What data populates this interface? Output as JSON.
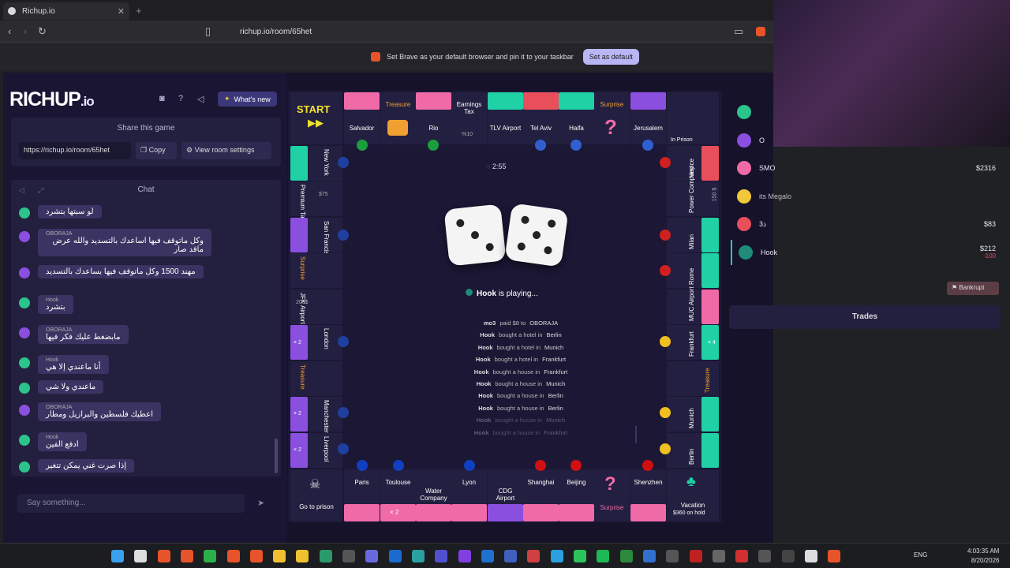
{
  "browser": {
    "tab_title": "Richup.io",
    "url": "richup.io/room/65het",
    "infobar_text": "Set Brave as your default browser and pin it to your taskbar",
    "infobar_button": "Set as default"
  },
  "app": {
    "logo": "RICHUP",
    "logo_suffix": ".io",
    "whats_new": "What's new",
    "share_title": "Share this game",
    "share_url": "https://richup.io/room/65het",
    "copy_label": "Copy",
    "view_room_label": "View room settings",
    "chat_title": "Chat",
    "say_placeholder": "Say something...",
    "chat": [
      {
        "name": "",
        "text": "لو سبتها بتشرد",
        "color": "#2bc48a"
      },
      {
        "name": "OBORAJA",
        "text": "وكل ماتوقف فيها اساعدك بالتسديد والله عرض ماقد صار",
        "color": "#8b4fe0"
      },
      {
        "name": "",
        "text": "مهند 1500 وكل ماتوقف فيها بساعدك بالتسديد",
        "color": "#8b4fe0"
      },
      {
        "name": "Hook",
        "text": "بتشرد",
        "color": "#2bc48a"
      },
      {
        "name": "OBORAJA",
        "text": "مابضغط عليك فكر فيها",
        "color": "#8b4fe0"
      },
      {
        "name": "Hook",
        "text": "أنا ماعندي إلا هي",
        "color": "#2bc48a"
      },
      {
        "name": "",
        "text": "ماعندي ولا شي",
        "color": "#2bc48a"
      },
      {
        "name": "OBORAJA",
        "text": "اعطيك فلسطين والبرازيل ومطار",
        "color": "#8b4fe0"
      },
      {
        "name": "Hook",
        "text": "ادفع الفين",
        "color": "#2bc48a"
      },
      {
        "name": "",
        "text": "إذا صرت غني يمكن تتغير",
        "color": "#2bc48a"
      }
    ]
  },
  "board": {
    "top": [
      "START",
      "Salvador",
      "Treasure",
      "Rio",
      "Earnings Tax",
      "TLV Airport",
      "Tel Aviv",
      "Haifa",
      "Surprise",
      "Jerusalem",
      "In Prison"
    ],
    "earnings_tax_value": "%10",
    "left": [
      "New York",
      "Premium Tax",
      "San Francisco",
      "Surprise",
      "JFK Airport",
      "London",
      "Treasure",
      "Manchester",
      "Liverpool"
    ],
    "premium_tax_value": "$75",
    "jfk_value": "200$",
    "right": [
      "Venice",
      "Power Company",
      "Milan",
      "Rome",
      "MUC Airport",
      "Frankfurt",
      "Treasure",
      "Munich",
      "Berlin"
    ],
    "power_value": "150 $",
    "bottom": [
      "Go to prison",
      "Paris",
      "Toulouse",
      "Water Company",
      "Lyon",
      "CDG Airport",
      "Shanghai",
      "Beijing",
      "Surprise",
      "Shenzhen",
      "Vacation"
    ],
    "vacation_sub": "$360 on hold",
    "badges": {
      "x2": "× 2",
      "x4": "× 4"
    },
    "timer": "2:55",
    "dice": [
      3,
      5
    ],
    "playing_name": "Hook",
    "playing_suffix": " is playing...",
    "log": [
      {
        "who": "mo3",
        "act": "paid $8 to",
        "where": "OBORAJA"
      },
      {
        "who": "Hook",
        "act": "bought a hotel in",
        "where": "Berlin"
      },
      {
        "who": "Hook",
        "act": "bought a hotel in",
        "where": "Munich"
      },
      {
        "who": "Hook",
        "act": "bought a hotel in",
        "where": "Frankfurt"
      },
      {
        "who": "Hook",
        "act": "bought a house in",
        "where": "Frankfurt"
      },
      {
        "who": "Hook",
        "act": "bought a house in",
        "where": "Munich"
      },
      {
        "who": "Hook",
        "act": "bought a house in",
        "where": "Berlin"
      },
      {
        "who": "Hook",
        "act": "bought a house in",
        "where": "Berlin"
      },
      {
        "who": "Hook",
        "act": "bought a house in",
        "where": "Munich"
      },
      {
        "who": "Hook",
        "act": "bought a house in",
        "where": "Frankfurt"
      }
    ]
  },
  "players": [
    {
      "name": "",
      "money": "",
      "color": "#2bc48a"
    },
    {
      "name": "O",
      "money": "",
      "color": "#8b4fe0"
    },
    {
      "name": "SMO",
      "money": "$2316",
      "color": "#f06aa8"
    },
    {
      "name": "its Megalo",
      "money": "",
      "color": "#f0c83a"
    },
    {
      "name": "ذ3",
      "money": "$83",
      "color": "#e94f5a"
    },
    {
      "name": "Hook",
      "money": "$212",
      "delta": "-100",
      "color": "#1e8c78"
    }
  ],
  "bankrupt": "Bankrupt",
  "trades": "Trades",
  "taskbar": {
    "lang": "ENG",
    "time": "4:03:35 AM",
    "date": "8/20/2026"
  }
}
